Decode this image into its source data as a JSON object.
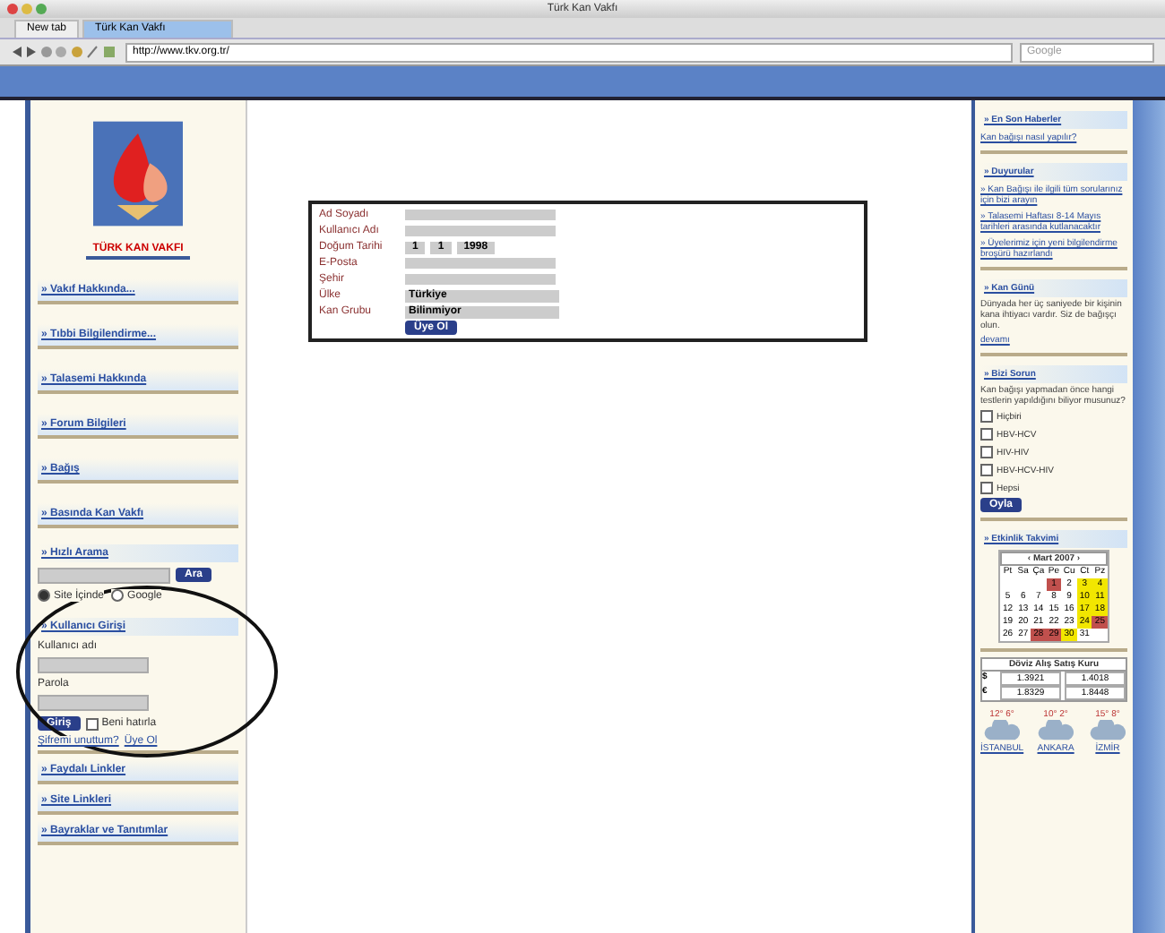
{
  "window": {
    "title": "Türk Kan Vakfı"
  },
  "tabs": [
    {
      "label": "New tab",
      "selected": false
    },
    {
      "label": "Türk Kan Vakfı",
      "selected": true
    }
  ],
  "address_bar": {
    "url": "http://www.tkv.org.tr/"
  },
  "search": {
    "placeholder": "Google"
  },
  "logo": {
    "caption": "TÜRK KAN VAKFI"
  },
  "left_menu": [
    {
      "label": "» Vakıf Hakkında..."
    },
    {
      "label": "» Tıbbi Bilgilendirme..."
    },
    {
      "label": "» Talasemi Hakkında"
    },
    {
      "label": "» Forum Bilgileri"
    },
    {
      "label": "» Bağış"
    },
    {
      "label": "» Basında Kan Vakfı"
    }
  ],
  "quick_search": {
    "title": "» Hızlı Arama",
    "button": "Ara",
    "options": [
      {
        "label": "Site İçinde",
        "selected": true
      },
      {
        "label": "Google",
        "selected": false
      }
    ]
  },
  "login": {
    "title": "» Kullanıcı Girişi",
    "username_label": "Kullanıcı adı",
    "password_label": "Parola",
    "button": "Giriş",
    "remember": {
      "label": "Beni hatırla",
      "checked": false
    },
    "forgot": "Şifremi unuttum?",
    "register": "Üye Ol"
  },
  "left_menu_bottom": [
    {
      "label": "» Faydalı Linkler"
    },
    {
      "label": "» Site Linkleri"
    },
    {
      "label": "» Bayraklar ve Tanıtımlar"
    }
  ],
  "form": {
    "fields": [
      {
        "label": "Ad Soyadı",
        "kind": "text"
      },
      {
        "label": "Kullanıcı Adı",
        "kind": "text"
      },
      {
        "label": "Doğum Tarihi",
        "kind": "date",
        "values": [
          "1",
          "1",
          "1998"
        ]
      },
      {
        "label": "E-Posta",
        "kind": "text"
      },
      {
        "label": "Şehir",
        "kind": "text"
      },
      {
        "label": "Ülke",
        "kind": "select",
        "value": "Türkiye"
      },
      {
        "label": "Kan Grubu",
        "kind": "select",
        "value": "Bilinmiyor"
      }
    ],
    "button": "Üye Ol"
  },
  "right": {
    "news": {
      "title": "» En Son Haberler",
      "items": [
        "Kan bağışı nasıl yapılır?"
      ]
    },
    "announcements": {
      "title": "» Duyurular",
      "items": [
        "» Kan Bağışı ile ilgili tüm sorularınız için bizi arayın",
        "» Talasemi Haftası 8-14 Mayıs tarihleri arasında kutlanacaktır",
        "» Üyelerimiz için yeni bilgilendirme broşürü hazırlandı"
      ]
    },
    "day_note": {
      "title": "» Kan Günü",
      "text": "Dünyada her üç saniyede bir kişinin kana ihtiyacı vardır. Siz de bağışçı olun.",
      "link": "devamı"
    },
    "poll": {
      "title": "» Bizi Sorun",
      "question": "Kan bağışı yapmadan önce hangi testlerin yapıldığını biliyor musunuz?",
      "options": [
        {
          "label": "Hiçbiri",
          "selected": false
        },
        {
          "label": "HBV-HCV",
          "selected": false
        },
        {
          "label": "HIV-HIV",
          "selected": false
        },
        {
          "label": "HBV-HCV-HIV",
          "selected": false
        },
        {
          "label": "Hepsi",
          "selected": false
        }
      ],
      "button": "Oyla"
    },
    "calendar": {
      "title": "» Etkinlik Takvimi",
      "month": "‹ Mart 2007 ›",
      "weekdays": [
        "Pt",
        "Sa",
        "Ça",
        "Pe",
        "Cu",
        "Ct",
        "Pz"
      ],
      "weeks": [
        [
          {
            "kind": "blank"
          },
          {
            "kind": "blank"
          },
          {
            "kind": "blank"
          },
          {
            "kind": "day",
            "label": "1",
            "color": "#c0504d"
          },
          {
            "kind": "day",
            "label": "2"
          },
          {
            "kind": "day",
            "label": "3",
            "color": "#f2e600"
          },
          {
            "kind": "day",
            "label": "4",
            "color": "#f2e600"
          }
        ],
        [
          {
            "kind": "day",
            "label": "5"
          },
          {
            "kind": "day",
            "label": "6"
          },
          {
            "kind": "day",
            "label": "7"
          },
          {
            "kind": "day",
            "label": "8"
          },
          {
            "kind": "day",
            "label": "9"
          },
          {
            "kind": "day",
            "label": "10",
            "color": "#f2e600"
          },
          {
            "kind": "day",
            "label": "11",
            "color": "#f2e600"
          }
        ],
        [
          {
            "kind": "day",
            "label": "12"
          },
          {
            "kind": "day",
            "label": "13"
          },
          {
            "kind": "day",
            "label": "14"
          },
          {
            "kind": "day",
            "label": "15"
          },
          {
            "kind": "day",
            "label": "16"
          },
          {
            "kind": "day",
            "label": "17",
            "color": "#f2e600"
          },
          {
            "kind": "day",
            "label": "18",
            "color": "#f2e600"
          }
        ],
        [
          {
            "kind": "day",
            "label": "19"
          },
          {
            "kind": "day",
            "label": "20"
          },
          {
            "kind": "day",
            "label": "21"
          },
          {
            "kind": "day",
            "label": "22"
          },
          {
            "kind": "day",
            "label": "23"
          },
          {
            "kind": "day",
            "label": "24",
            "color": "#f2e600"
          },
          {
            "kind": "day",
            "label": "25",
            "color": "#c0504d"
          }
        ],
        [
          {
            "kind": "day",
            "label": "26"
          },
          {
            "kind": "day",
            "label": "27"
          },
          {
            "kind": "day",
            "label": "28",
            "color": "#c0504d"
          },
          {
            "kind": "day",
            "label": "29",
            "color": "#c0504d"
          },
          {
            "kind": "day",
            "label": "30",
            "color": "#f2e600"
          },
          {
            "kind": "day",
            "label": "31"
          },
          {
            "kind": "blank"
          }
        ]
      ]
    },
    "currency": {
      "title": "Döviz Alış Satış Kuru",
      "rows": [
        {
          "symbol": "$",
          "buy": "1.3921",
          "sell": "1.4018"
        },
        {
          "symbol": "€",
          "buy": "1.8329",
          "sell": "1.8448"
        }
      ]
    },
    "weather": [
      {
        "city": "İSTANBUL",
        "temp": "12° 6°"
      },
      {
        "city": "ANKARA",
        "temp": "10° 2°"
      },
      {
        "city": "İZMİR",
        "temp": "15° 8°"
      }
    ]
  }
}
